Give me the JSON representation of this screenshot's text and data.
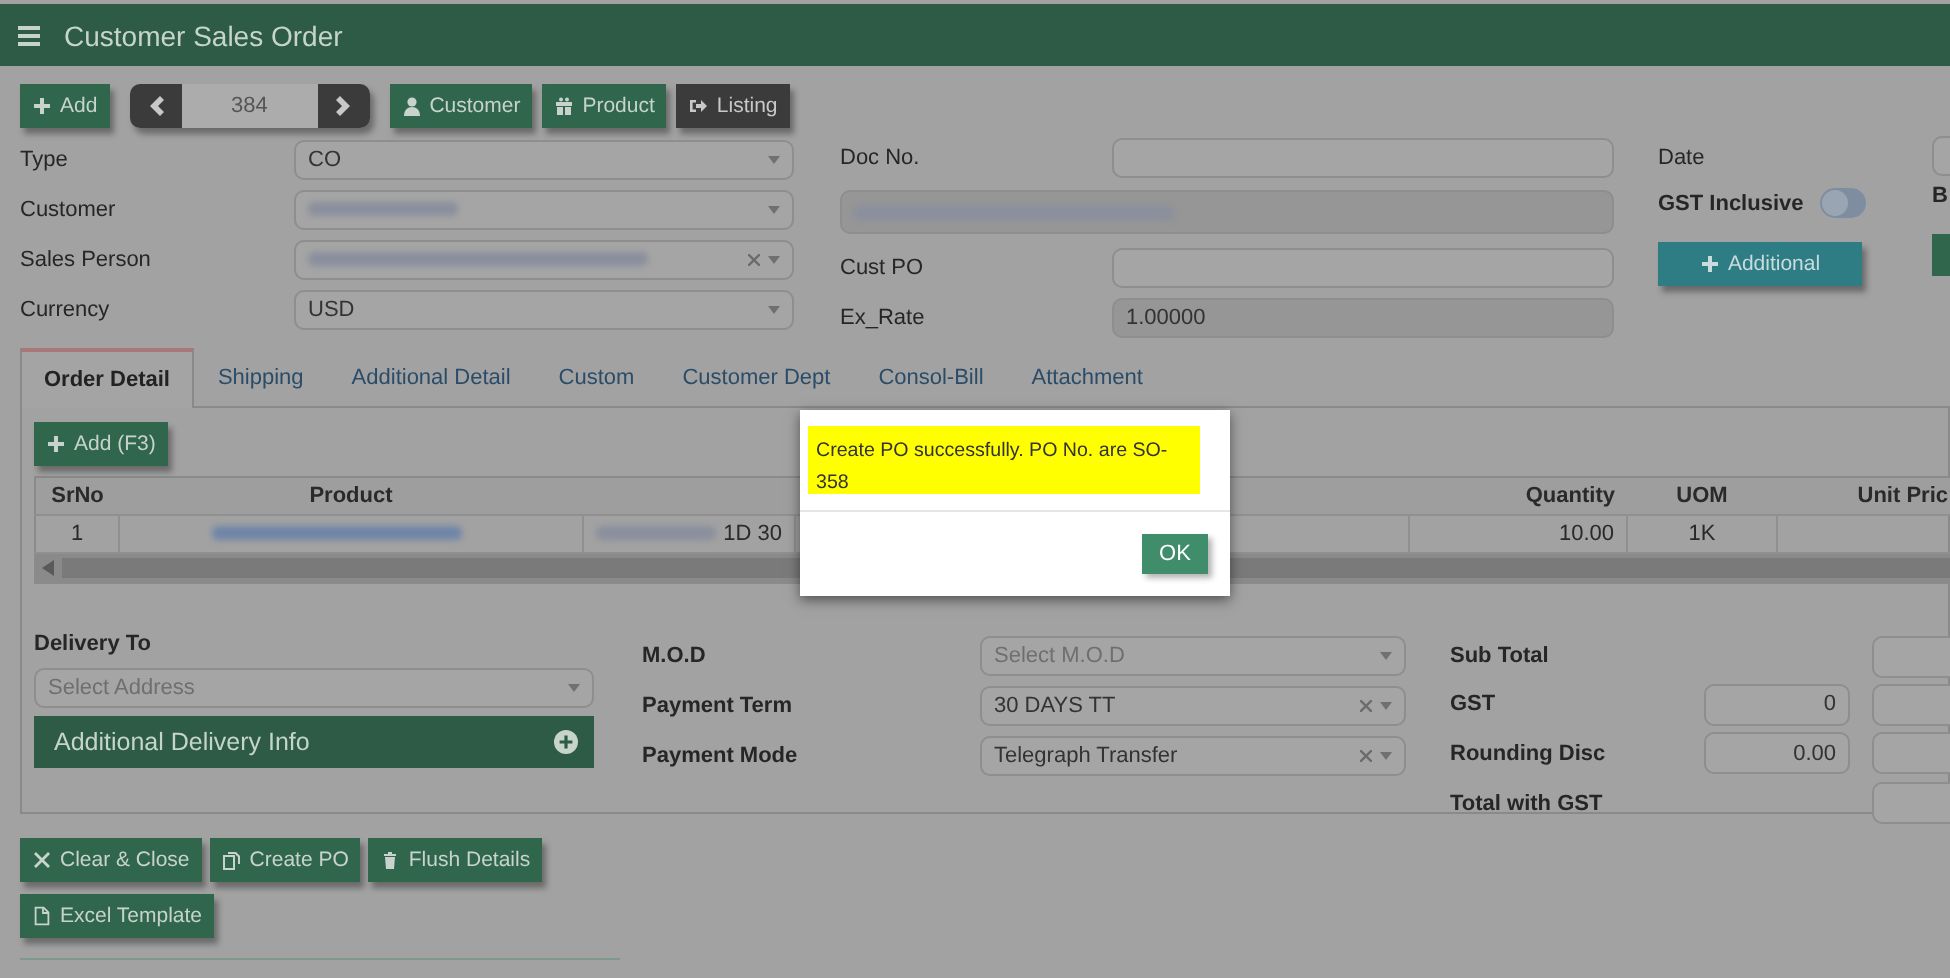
{
  "header": {
    "title": "Customer Sales Order"
  },
  "toolbar": {
    "add": "Add",
    "record": "384",
    "buttons": [
      {
        "label": "Customer",
        "kind": "customer"
      },
      {
        "label": "Product",
        "kind": "product"
      },
      {
        "label": "Listing",
        "kind": "listing"
      }
    ]
  },
  "form_left": [
    {
      "label": "Type",
      "value": "CO",
      "clearable": false,
      "redacted": false
    },
    {
      "label": "Customer",
      "clearable": false,
      "redacted": true
    },
    {
      "label": "Sales Person",
      "clearable": true,
      "redacted": true
    },
    {
      "label": "Currency",
      "value": "USD",
      "clearable": false,
      "redacted": false
    }
  ],
  "form_middle": [
    {
      "label": "Doc No.",
      "readonly": false,
      "redacted": false
    },
    {
      "readonly": true,
      "redacted": true
    },
    {
      "label": "Cust PO",
      "readonly": false,
      "redacted": false
    },
    {
      "label": "Ex_Rate",
      "value": "1.00000",
      "readonly": true,
      "redacted": false
    }
  ],
  "form_right": {
    "date_label": "Date",
    "gst_label": "GST Inclusive",
    "gst_inclusive": false,
    "additional": "Additional",
    "cut_label": "B"
  },
  "tabs": [
    {
      "label": "Order Detail",
      "selected": true
    },
    {
      "label": "Shipping",
      "selected": false
    },
    {
      "label": "Additional Detail",
      "selected": false
    },
    {
      "label": "Custom",
      "selected": false
    },
    {
      "label": "Customer Dept",
      "selected": false
    },
    {
      "label": "Consol-Bill",
      "selected": false
    },
    {
      "label": "Attachment",
      "selected": false
    }
  ],
  "add_line": "Add (F3)",
  "table": {
    "columns": {
      "srno": "SrNo",
      "product": "Product",
      "quantity": "Quantity",
      "uom": "UOM",
      "unit_price": "Unit Pric"
    },
    "rows": [
      {
        "srno": "1",
        "product_redacted": true,
        "column_3": "1D 30",
        "quantity": "10.00",
        "uom": "1K"
      }
    ]
  },
  "delivery": {
    "label": "Delivery To",
    "placeholder": "Select Address",
    "info": "Additional Delivery Info"
  },
  "payment": [
    {
      "label": "M.O.D",
      "placeholder": "Select M.O.D",
      "clearable": false
    },
    {
      "label": "Payment Term",
      "value": "30 DAYS TT",
      "clearable": true
    },
    {
      "label": "Payment Mode",
      "value": "Telegraph Transfer",
      "clearable": true
    }
  ],
  "totals": [
    {
      "label": "Sub Total"
    },
    {
      "label": "GST",
      "value": "0"
    },
    {
      "label": "Rounding Disc",
      "value": "0.00"
    },
    {
      "label": "Total with GST"
    }
  ],
  "actions": [
    {
      "label": "Clear & Close",
      "kind": "clear"
    },
    {
      "label": "Create PO",
      "kind": "copy"
    },
    {
      "label": "Flush Details",
      "kind": "trash"
    },
    {
      "label": "Excel Template",
      "kind": "file"
    }
  ],
  "dialog": {
    "message": "Create PO successfully. PO No. are SO-358",
    "ok": "OK"
  }
}
